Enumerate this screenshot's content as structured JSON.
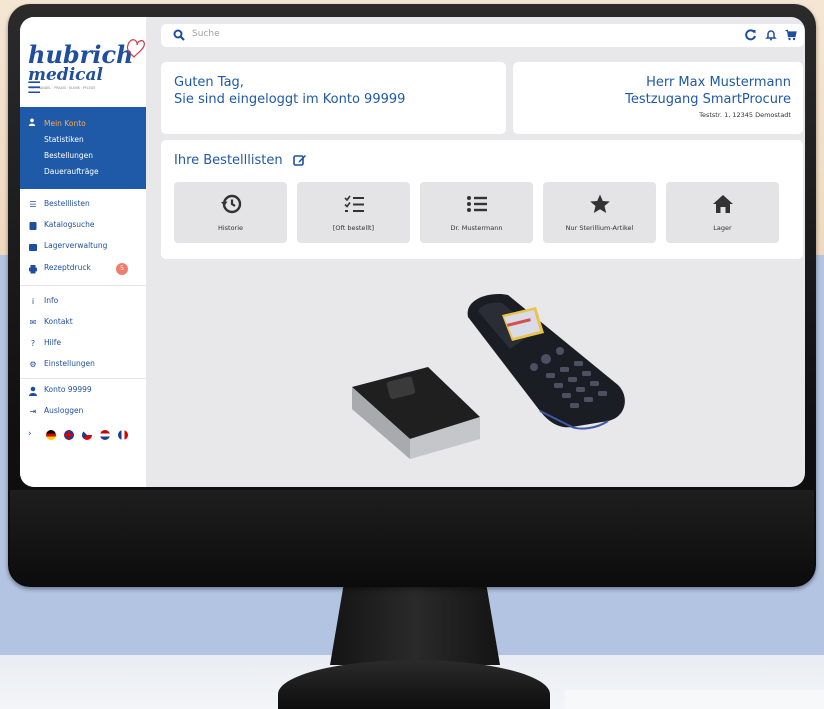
{
  "brand": {
    "name": "hubrich",
    "sub": "medical",
    "tagline": "FACHHANDEL · PRAXIS · KLINIK · PFLEGE"
  },
  "sidebar": {
    "account_section": [
      {
        "label": "Mein Konto"
      },
      {
        "label": "Statistiken"
      },
      {
        "label": "Bestellungen"
      },
      {
        "label": "Daueraufträge"
      }
    ],
    "main_items": [
      {
        "label": "Bestelllisten"
      },
      {
        "label": "Katalogsuche"
      },
      {
        "label": "Lagerverwaltung"
      },
      {
        "label": "Rezeptdruck",
        "badge": "5"
      }
    ],
    "service_items": [
      {
        "label": "Info"
      },
      {
        "label": "Kontakt"
      },
      {
        "label": "Hilfe"
      },
      {
        "label": "Einstellungen"
      }
    ],
    "account_items": [
      {
        "label": "Konto 99999"
      },
      {
        "label": "Ausloggen"
      }
    ]
  },
  "search": {
    "placeholder": "Suche"
  },
  "greeting": {
    "line1": "Guten Tag,",
    "line2": "Sie sind eingeloggt im Konto 99999"
  },
  "user": {
    "name": "Herr Max Mustermann",
    "company": "Testzugang SmartProcure",
    "address": "Teststr. 1, 12345 Demostadt"
  },
  "order_lists": {
    "title": "Ihre Bestelllisten",
    "tiles": [
      {
        "label": "Historie",
        "icon": "history-icon"
      },
      {
        "label": "[Oft bestellt]",
        "icon": "checklist-icon"
      },
      {
        "label": "Dr. Mustermann",
        "icon": "list-icon"
      },
      {
        "label": "Nur Sterillium-Artikel",
        "icon": "star-icon"
      },
      {
        "label": "Lager",
        "icon": "home-icon"
      }
    ]
  },
  "colors": {
    "primary": "#1f59a8",
    "accent": "#ffa94d",
    "badge": "#f07c6e"
  }
}
